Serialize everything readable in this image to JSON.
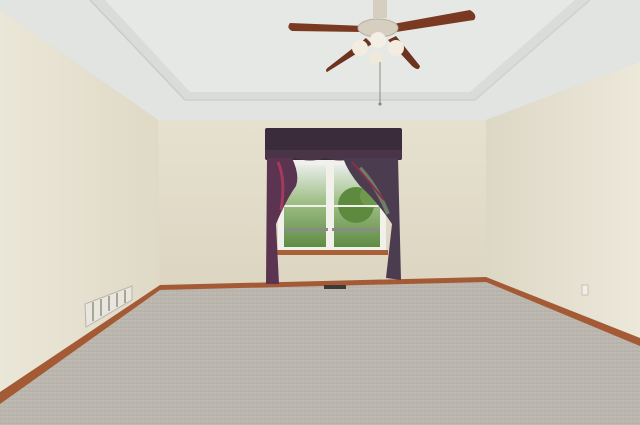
{
  "scene": {
    "description_free": true,
    "colors": {
      "ceiling": "#e4e6e3",
      "ceiling_tray": "#dcdfdc",
      "wall_back": "#e2dcc9",
      "wall_left": "#e6e1d0",
      "wall_right": "#e4dfcf",
      "baseboard": "#a45a34",
      "carpet": "#bcb7b0",
      "curtain": "#3a2c3a",
      "curtain_accent": "#7a3048",
      "window_frame": "#f4f2ec",
      "outside_green": "#6f9a52",
      "fan_blade": "#7a3a22",
      "fan_body": "#d6cfc0"
    },
    "icons": [
      "ceiling-fan-icon",
      "floor-vent-icon",
      "window-icon",
      "curtain-icon",
      "outlet-icon"
    ]
  }
}
